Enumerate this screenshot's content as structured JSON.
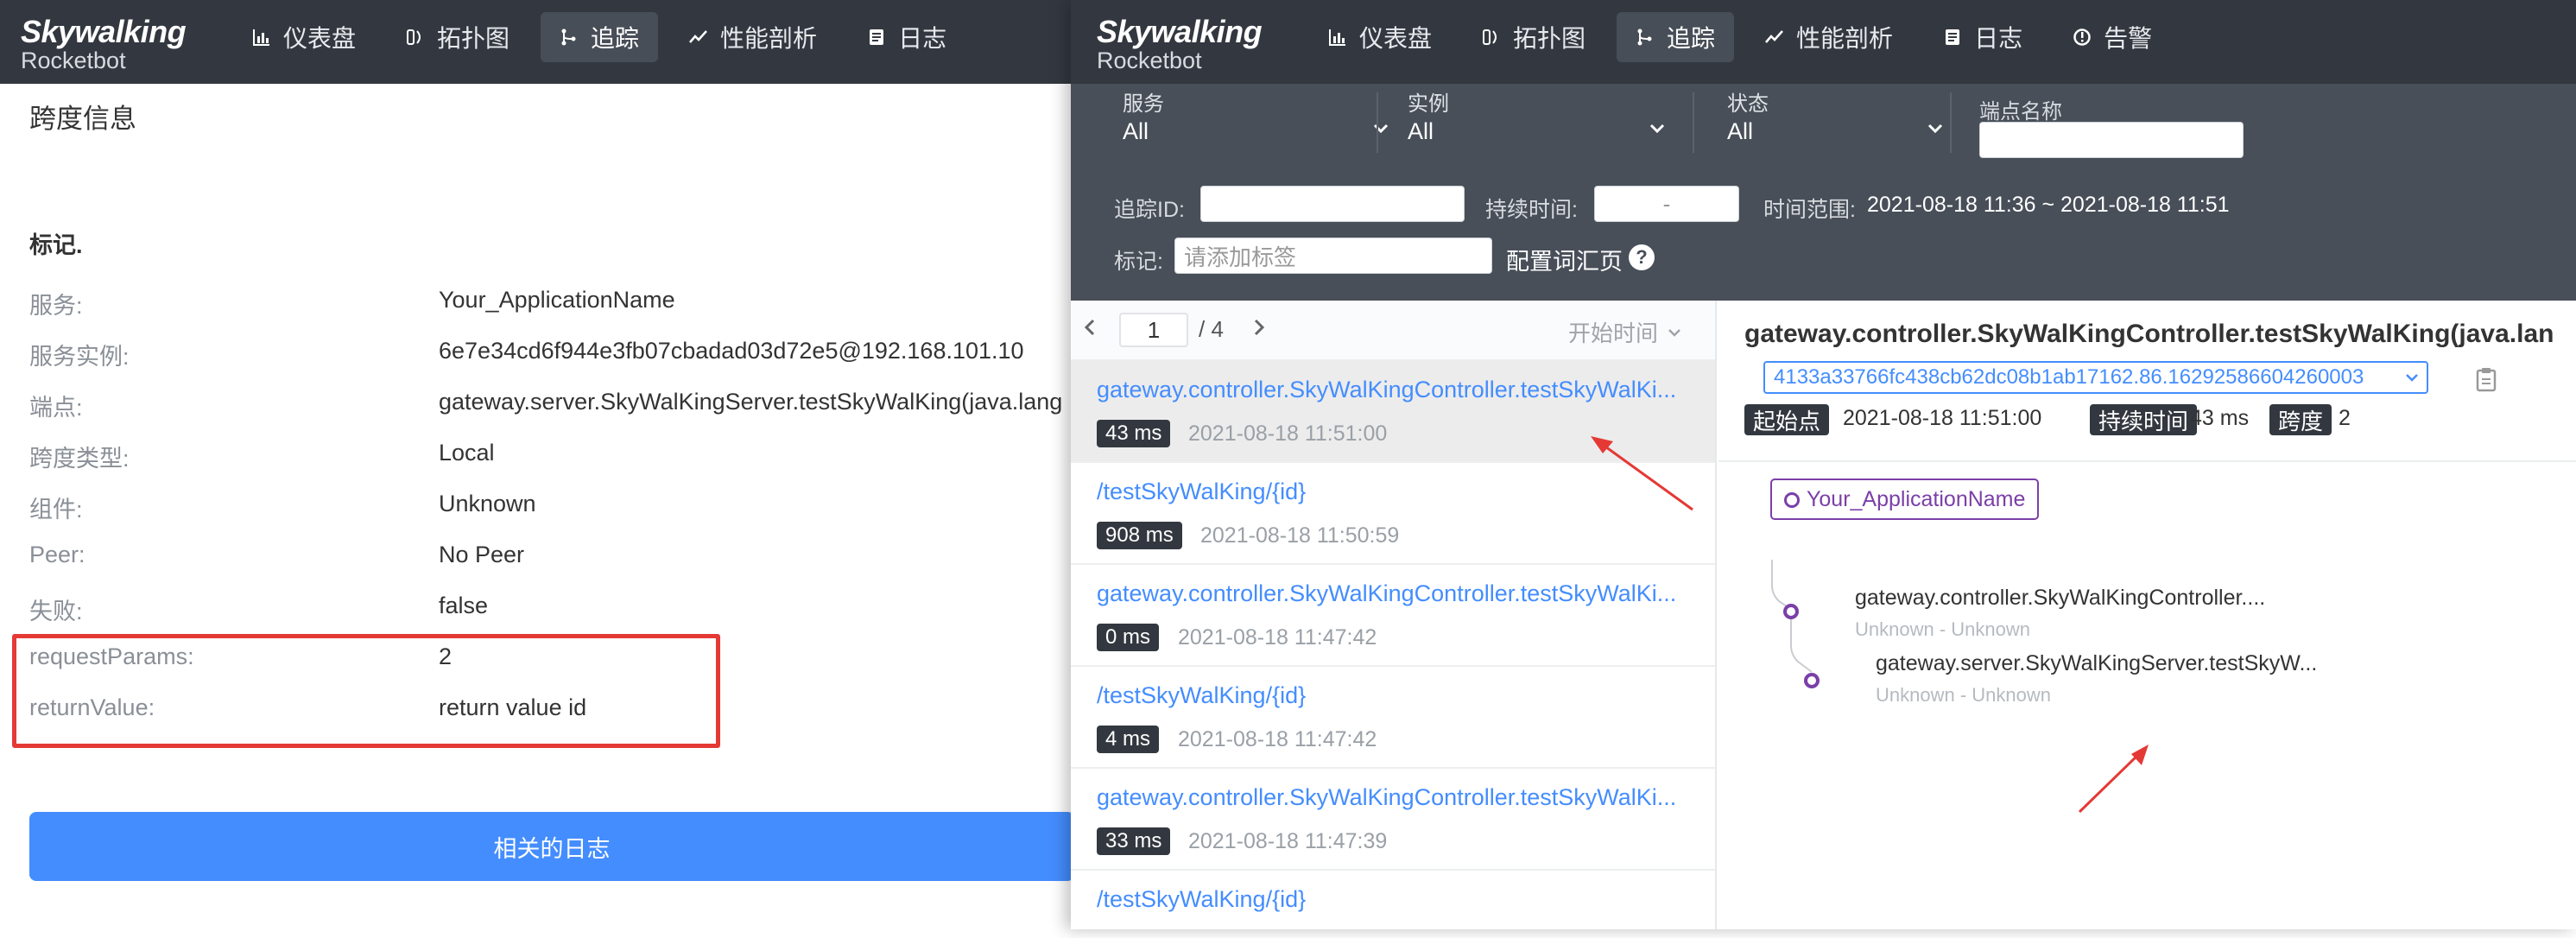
{
  "left": {
    "logo": {
      "line1": "Skywalking",
      "line2": "Rocketbot"
    },
    "nav": [
      {
        "label": "仪表盘",
        "icon": "dashboard-icon"
      },
      {
        "label": "拓扑图",
        "icon": "topology-icon"
      },
      {
        "label": "追踪",
        "icon": "trace-icon"
      },
      {
        "label": "性能剖析",
        "icon": "profile-icon"
      },
      {
        "label": "日志",
        "icon": "log-icon"
      }
    ],
    "span_title": "跨度信息",
    "tags_heading": "标记.",
    "fields": [
      {
        "key": "服务:",
        "value": "Your_ApplicationName"
      },
      {
        "key": "服务实例:",
        "value": "6e7e34cd6f944e3fb07cbadad03d72e5@192.168.101.10"
      },
      {
        "key": "端点:",
        "value": "gateway.server.SkyWalKingServer.testSkyWalKing(java.lang"
      },
      {
        "key": "跨度类型:",
        "value": "Local"
      },
      {
        "key": "组件:",
        "value": "Unknown"
      },
      {
        "key": "Peer:",
        "value": "No Peer"
      },
      {
        "key": "失败:",
        "value": "false"
      },
      {
        "key": "requestParams:",
        "value": "2"
      },
      {
        "key": "returnValue:",
        "value": "return value id"
      }
    ],
    "related_logs_button": "相关的日志"
  },
  "right": {
    "logo": {
      "line1": "Skywalking",
      "line2": "Rocketbot"
    },
    "nav": [
      {
        "label": "仪表盘",
        "icon": "dashboard-icon"
      },
      {
        "label": "拓扑图",
        "icon": "topology-icon"
      },
      {
        "label": "追踪",
        "icon": "trace-icon"
      },
      {
        "label": "性能剖析",
        "icon": "profile-icon"
      },
      {
        "label": "日志",
        "icon": "log-icon"
      },
      {
        "label": "告警",
        "icon": "alarm-icon"
      }
    ],
    "filters": {
      "service": {
        "label": "服务",
        "value": "All"
      },
      "instance": {
        "label": "实例",
        "value": "All"
      },
      "status": {
        "label": "状态",
        "value": "All"
      },
      "endpoint": {
        "label": "端点名称",
        "value": ""
      },
      "trace_id_label": "追踪ID:",
      "duration_label": "持续时间:",
      "duration_placeholder": "-",
      "time_range_label": "时间范围:",
      "time_range_value": "2021-08-18 11:36 ~ 2021-08-18 11:51",
      "tags_label": "标记:",
      "tags_placeholder": "请添加标签",
      "vocab_label": "配置词汇页",
      "help": "?"
    },
    "pager": {
      "current": "1",
      "total": "/ 4",
      "sort_label": "开始时间"
    },
    "traces": [
      {
        "name": "gateway.controller.SkyWalKingController.testSkyWalKi...",
        "duration": "43 ms",
        "time": "2021-08-18 11:51:00"
      },
      {
        "name": "/testSkyWalKing/{id}",
        "duration": "908 ms",
        "time": "2021-08-18 11:50:59"
      },
      {
        "name": "gateway.controller.SkyWalKingController.testSkyWalKi...",
        "duration": "0 ms",
        "time": "2021-08-18 11:47:42"
      },
      {
        "name": "/testSkyWalKing/{id}",
        "duration": "4 ms",
        "time": "2021-08-18 11:47:42"
      },
      {
        "name": "gateway.controller.SkyWalKingController.testSkyWalKi...",
        "duration": "33 ms",
        "time": "2021-08-18 11:47:39"
      },
      {
        "name": "/testSkyWalKing/{id}",
        "duration": "",
        "time": ""
      }
    ],
    "detail": {
      "title": "gateway.controller.SkyWalKingController.testSkyWalKing(java.lan",
      "trace_id": "4133a33766fc438cb62dc08b1ab17162.86.16292586604260003",
      "start_label": "起始点",
      "start_value": "2021-08-18 11:51:00",
      "duration_label": "持续时间",
      "duration_value": "43 ms",
      "span_label": "跨度",
      "span_value": "2",
      "service_chip": "Your_ApplicationName",
      "nodes": [
        {
          "name": "gateway.controller.SkyWalKingController....",
          "sub": "Unknown - Unknown"
        },
        {
          "name": "gateway.server.SkyWalKingServer.testSkyW...",
          "sub": "Unknown - Unknown"
        }
      ]
    }
  },
  "colors": {
    "topbar": "#333840",
    "filter_bar": "#484f59",
    "link_blue": "#448dfe",
    "highlight_red": "#e53935",
    "service_purple": "#7b3fa8"
  }
}
